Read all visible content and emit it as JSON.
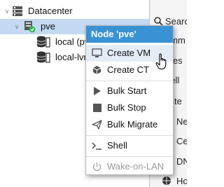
{
  "tree": {
    "datacenter": {
      "label": "Datacenter",
      "icon": "server-rack-icon",
      "expanded": true
    },
    "node": {
      "label": "pve",
      "icon": "node-server-icon",
      "status_icon": "check-circle-icon",
      "status_color": "#21bf4b",
      "expanded": true,
      "selected": true
    },
    "storages": [
      {
        "label": "local (pv",
        "icon": "storage-db-icon"
      },
      {
        "label": "local-lvn",
        "icon": "storage-db-icon"
      }
    ]
  },
  "right_panel": {
    "items": [
      {
        "label": "Searc",
        "icon": "search-icon"
      },
      {
        "label": "umm",
        "icon": "summary-icon"
      },
      {
        "label": "otes",
        "icon": "notes-icon"
      },
      {
        "label": "hell",
        "icon": "shell-icon"
      },
      {
        "label": "yste",
        "icon": "system-icon"
      },
      {
        "label": "Ne",
        "icon": "network-icon"
      },
      {
        "label": "Ce",
        "icon": "certificates-icon"
      },
      {
        "label": "DN",
        "icon": "dns-icon"
      },
      {
        "label": "Ho",
        "icon": "hosts-icon"
      }
    ]
  },
  "context_menu": {
    "title": "Node 'pve'",
    "header_color": "#3892d4",
    "items": [
      {
        "label": "Create VM",
        "icon": "monitor-icon",
        "hovered": true
      },
      {
        "label": "Create CT",
        "icon": "cube-icon"
      },
      {
        "label": "Bulk Start",
        "icon": "play-icon"
      },
      {
        "label": "Bulk Stop",
        "icon": "stop-icon"
      },
      {
        "label": "Bulk Migrate",
        "icon": "send-icon"
      },
      {
        "label": "Shell",
        "icon": "terminal-icon"
      },
      {
        "label": "Wake-on-LAN",
        "icon": "power-icon",
        "disabled": true
      }
    ]
  }
}
